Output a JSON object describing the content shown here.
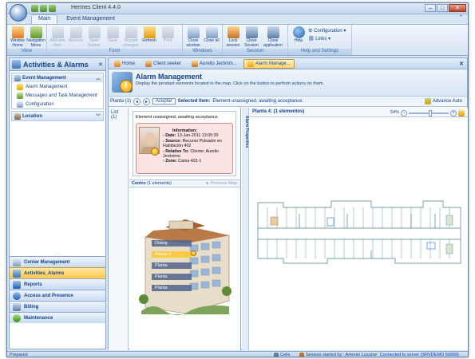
{
  "window": {
    "title": "Hermes Client 4.4.0",
    "controls": {
      "minimize": "–",
      "maximize": "□",
      "close": "✕"
    }
  },
  "ribbon_tabs": [
    {
      "label": "Main"
    },
    {
      "label": "Event Management"
    }
  ],
  "ribbon": {
    "groups": [
      {
        "label": "View",
        "buttons": [
          {
            "label": "Window Home",
            "icon": "home-icon"
          },
          {
            "label": "Navigation Menu",
            "icon": "nav-menu-icon"
          }
        ]
      },
      {
        "label": "Form",
        "buttons": [
          {
            "label": "Add new item",
            "icon": "add-icon",
            "disabled": true
          },
          {
            "label": "Remove",
            "icon": "remove-icon",
            "disabled": true
          },
          {
            "label": "Open Seeker",
            "icon": "search-icon",
            "disabled": true
          },
          {
            "label": "Save",
            "icon": "save-icon",
            "disabled": true
          },
          {
            "label": "Discard changes",
            "icon": "undo-icon",
            "disabled": true
          },
          {
            "label": "Refresh",
            "icon": "refresh-icon"
          },
          {
            "label": "Print",
            "icon": "print-icon",
            "disabled": true
          }
        ]
      },
      {
        "label": "Windows",
        "buttons": [
          {
            "label": "Close window",
            "icon": "close-window-icon"
          },
          {
            "label": "Close all",
            "icon": "close-all-icon"
          }
        ]
      },
      {
        "label": "Session",
        "buttons": [
          {
            "label": "Lock session",
            "icon": "lock-icon"
          },
          {
            "label": "Close Session",
            "icon": "close-session-icon"
          },
          {
            "label": "Close application",
            "icon": "exit-icon"
          }
        ]
      },
      {
        "label": "Help and Settings",
        "buttons": [
          {
            "label": "Help",
            "icon": "help-icon"
          }
        ],
        "links": [
          "Configuration",
          "Links"
        ]
      }
    ]
  },
  "sidebar": {
    "title": "Activities & Alarms",
    "close": "✕",
    "sections": [
      {
        "label": "Event Management",
        "items": [
          "Alarm Management",
          "Messages and Task Management",
          "Configuration"
        ]
      },
      {
        "label": "Location",
        "items": []
      }
    ],
    "grip": "·····",
    "nav": [
      "Center Management",
      "Activities_Alarms",
      "Reports",
      "Access and Presence",
      "Billing",
      "Maintenance"
    ],
    "active_nav": "Activities_Alarms"
  },
  "doc_tabs": [
    {
      "label": "Home"
    },
    {
      "label": "Client seeker"
    },
    {
      "label": "Aurelio Jerónim..."
    },
    {
      "label": "Alarm Manage...",
      "active": true
    }
  ],
  "header": {
    "title": "Alarm Management",
    "subtitle": "Display the pendant elements located in the map. Click on the button to perform actions on them."
  },
  "toolbar": {
    "planta": "Planta (1)",
    "accept": "Aceptar",
    "selected_label": "Selected Item:",
    "selected_value": "Element unassigned, awaiting acceptance.",
    "advance_auto": "Advance Auto"
  },
  "list_label": "List (1)",
  "alert": {
    "status": "Element unassigned, awaiting acceptance.",
    "info_title": "Information:",
    "fields": [
      {
        "label": "- Date:",
        "value": "13-Jan-2011 13:05:39"
      },
      {
        "label": "- Source:",
        "value": "Recurso Pulsador en Habitación 402"
      },
      {
        "label": "- Relative To:",
        "value": "Cliente: Aurelio Jerónimo"
      },
      {
        "label": "- Zone:",
        "value": "Cama 402-1"
      }
    ]
  },
  "centro": {
    "label": "Centro",
    "count": "(1 elements)",
    "prev_map": "◄ Previous Map"
  },
  "building_floors": [
    "Dialog",
    "Planta 4",
    "Planta",
    "Planta",
    "Planta"
  ],
  "alarm_properties": "Alarm Properties",
  "plan": {
    "label": "Planta 4: (1 elementos)",
    "zoom": "54%",
    "zoom_pct": 54
  },
  "statusbar": {
    "left": "Prepared",
    "cells": "Cells",
    "session": "Session started by : Antonio Lozano",
    "connection": "Connected to server (SRVDEMO 59999)"
  },
  "colors": {
    "accent": "#15428b",
    "alarm_bg": "#fbe3e3",
    "active_tab": "#ffd46e"
  }
}
